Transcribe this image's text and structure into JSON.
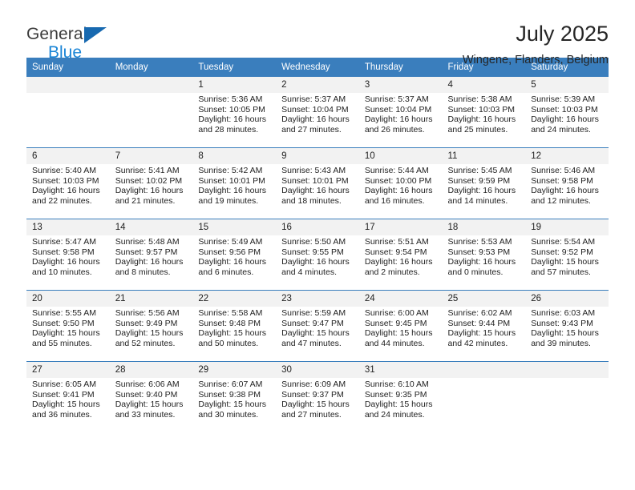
{
  "brand": {
    "line1": "General",
    "line2": "Blue",
    "triangle_color": "#1769b0",
    "blue_text_color": "#1a85d6"
  },
  "header": {
    "title": "July 2025",
    "subtitle": "Wingene, Flanders, Belgium"
  },
  "theme": {
    "header_blue": "#3a7ebd",
    "daynum_band": "#f2f2f2",
    "text": "#222222"
  },
  "weekday_headers": [
    "Sunday",
    "Monday",
    "Tuesday",
    "Wednesday",
    "Thursday",
    "Friday",
    "Saturday"
  ],
  "labels": {
    "sunrise": "Sunrise:",
    "sunset": "Sunset:",
    "daylight": "Daylight:"
  },
  "weeks": [
    [
      {
        "day": "",
        "sunrise": "",
        "sunset": "",
        "daylight_1": "",
        "daylight_2": ""
      },
      {
        "day": "",
        "sunrise": "",
        "sunset": "",
        "daylight_1": "",
        "daylight_2": ""
      },
      {
        "day": "1",
        "sunrise": "Sunrise: 5:36 AM",
        "sunset": "Sunset: 10:05 PM",
        "daylight_1": "Daylight: 16 hours",
        "daylight_2": "and 28 minutes."
      },
      {
        "day": "2",
        "sunrise": "Sunrise: 5:37 AM",
        "sunset": "Sunset: 10:04 PM",
        "daylight_1": "Daylight: 16 hours",
        "daylight_2": "and 27 minutes."
      },
      {
        "day": "3",
        "sunrise": "Sunrise: 5:37 AM",
        "sunset": "Sunset: 10:04 PM",
        "daylight_1": "Daylight: 16 hours",
        "daylight_2": "and 26 minutes."
      },
      {
        "day": "4",
        "sunrise": "Sunrise: 5:38 AM",
        "sunset": "Sunset: 10:03 PM",
        "daylight_1": "Daylight: 16 hours",
        "daylight_2": "and 25 minutes."
      },
      {
        "day": "5",
        "sunrise": "Sunrise: 5:39 AM",
        "sunset": "Sunset: 10:03 PM",
        "daylight_1": "Daylight: 16 hours",
        "daylight_2": "and 24 minutes."
      }
    ],
    [
      {
        "day": "6",
        "sunrise": "Sunrise: 5:40 AM",
        "sunset": "Sunset: 10:03 PM",
        "daylight_1": "Daylight: 16 hours",
        "daylight_2": "and 22 minutes."
      },
      {
        "day": "7",
        "sunrise": "Sunrise: 5:41 AM",
        "sunset": "Sunset: 10:02 PM",
        "daylight_1": "Daylight: 16 hours",
        "daylight_2": "and 21 minutes."
      },
      {
        "day": "8",
        "sunrise": "Sunrise: 5:42 AM",
        "sunset": "Sunset: 10:01 PM",
        "daylight_1": "Daylight: 16 hours",
        "daylight_2": "and 19 minutes."
      },
      {
        "day": "9",
        "sunrise": "Sunrise: 5:43 AM",
        "sunset": "Sunset: 10:01 PM",
        "daylight_1": "Daylight: 16 hours",
        "daylight_2": "and 18 minutes."
      },
      {
        "day": "10",
        "sunrise": "Sunrise: 5:44 AM",
        "sunset": "Sunset: 10:00 PM",
        "daylight_1": "Daylight: 16 hours",
        "daylight_2": "and 16 minutes."
      },
      {
        "day": "11",
        "sunrise": "Sunrise: 5:45 AM",
        "sunset": "Sunset: 9:59 PM",
        "daylight_1": "Daylight: 16 hours",
        "daylight_2": "and 14 minutes."
      },
      {
        "day": "12",
        "sunrise": "Sunrise: 5:46 AM",
        "sunset": "Sunset: 9:58 PM",
        "daylight_1": "Daylight: 16 hours",
        "daylight_2": "and 12 minutes."
      }
    ],
    [
      {
        "day": "13",
        "sunrise": "Sunrise: 5:47 AM",
        "sunset": "Sunset: 9:58 PM",
        "daylight_1": "Daylight: 16 hours",
        "daylight_2": "and 10 minutes."
      },
      {
        "day": "14",
        "sunrise": "Sunrise: 5:48 AM",
        "sunset": "Sunset: 9:57 PM",
        "daylight_1": "Daylight: 16 hours",
        "daylight_2": "and 8 minutes."
      },
      {
        "day": "15",
        "sunrise": "Sunrise: 5:49 AM",
        "sunset": "Sunset: 9:56 PM",
        "daylight_1": "Daylight: 16 hours",
        "daylight_2": "and 6 minutes."
      },
      {
        "day": "16",
        "sunrise": "Sunrise: 5:50 AM",
        "sunset": "Sunset: 9:55 PM",
        "daylight_1": "Daylight: 16 hours",
        "daylight_2": "and 4 minutes."
      },
      {
        "day": "17",
        "sunrise": "Sunrise: 5:51 AM",
        "sunset": "Sunset: 9:54 PM",
        "daylight_1": "Daylight: 16 hours",
        "daylight_2": "and 2 minutes."
      },
      {
        "day": "18",
        "sunrise": "Sunrise: 5:53 AM",
        "sunset": "Sunset: 9:53 PM",
        "daylight_1": "Daylight: 16 hours",
        "daylight_2": "and 0 minutes."
      },
      {
        "day": "19",
        "sunrise": "Sunrise: 5:54 AM",
        "sunset": "Sunset: 9:52 PM",
        "daylight_1": "Daylight: 15 hours",
        "daylight_2": "and 57 minutes."
      }
    ],
    [
      {
        "day": "20",
        "sunrise": "Sunrise: 5:55 AM",
        "sunset": "Sunset: 9:50 PM",
        "daylight_1": "Daylight: 15 hours",
        "daylight_2": "and 55 minutes."
      },
      {
        "day": "21",
        "sunrise": "Sunrise: 5:56 AM",
        "sunset": "Sunset: 9:49 PM",
        "daylight_1": "Daylight: 15 hours",
        "daylight_2": "and 52 minutes."
      },
      {
        "day": "22",
        "sunrise": "Sunrise: 5:58 AM",
        "sunset": "Sunset: 9:48 PM",
        "daylight_1": "Daylight: 15 hours",
        "daylight_2": "and 50 minutes."
      },
      {
        "day": "23",
        "sunrise": "Sunrise: 5:59 AM",
        "sunset": "Sunset: 9:47 PM",
        "daylight_1": "Daylight: 15 hours",
        "daylight_2": "and 47 minutes."
      },
      {
        "day": "24",
        "sunrise": "Sunrise: 6:00 AM",
        "sunset": "Sunset: 9:45 PM",
        "daylight_1": "Daylight: 15 hours",
        "daylight_2": "and 44 minutes."
      },
      {
        "day": "25",
        "sunrise": "Sunrise: 6:02 AM",
        "sunset": "Sunset: 9:44 PM",
        "daylight_1": "Daylight: 15 hours",
        "daylight_2": "and 42 minutes."
      },
      {
        "day": "26",
        "sunrise": "Sunrise: 6:03 AM",
        "sunset": "Sunset: 9:43 PM",
        "daylight_1": "Daylight: 15 hours",
        "daylight_2": "and 39 minutes."
      }
    ],
    [
      {
        "day": "27",
        "sunrise": "Sunrise: 6:05 AM",
        "sunset": "Sunset: 9:41 PM",
        "daylight_1": "Daylight: 15 hours",
        "daylight_2": "and 36 minutes."
      },
      {
        "day": "28",
        "sunrise": "Sunrise: 6:06 AM",
        "sunset": "Sunset: 9:40 PM",
        "daylight_1": "Daylight: 15 hours",
        "daylight_2": "and 33 minutes."
      },
      {
        "day": "29",
        "sunrise": "Sunrise: 6:07 AM",
        "sunset": "Sunset: 9:38 PM",
        "daylight_1": "Daylight: 15 hours",
        "daylight_2": "and 30 minutes."
      },
      {
        "day": "30",
        "sunrise": "Sunrise: 6:09 AM",
        "sunset": "Sunset: 9:37 PM",
        "daylight_1": "Daylight: 15 hours",
        "daylight_2": "and 27 minutes."
      },
      {
        "day": "31",
        "sunrise": "Sunrise: 6:10 AM",
        "sunset": "Sunset: 9:35 PM",
        "daylight_1": "Daylight: 15 hours",
        "daylight_2": "and 24 minutes."
      },
      {
        "day": "",
        "sunrise": "",
        "sunset": "",
        "daylight_1": "",
        "daylight_2": ""
      },
      {
        "day": "",
        "sunrise": "",
        "sunset": "",
        "daylight_1": "",
        "daylight_2": ""
      }
    ]
  ]
}
